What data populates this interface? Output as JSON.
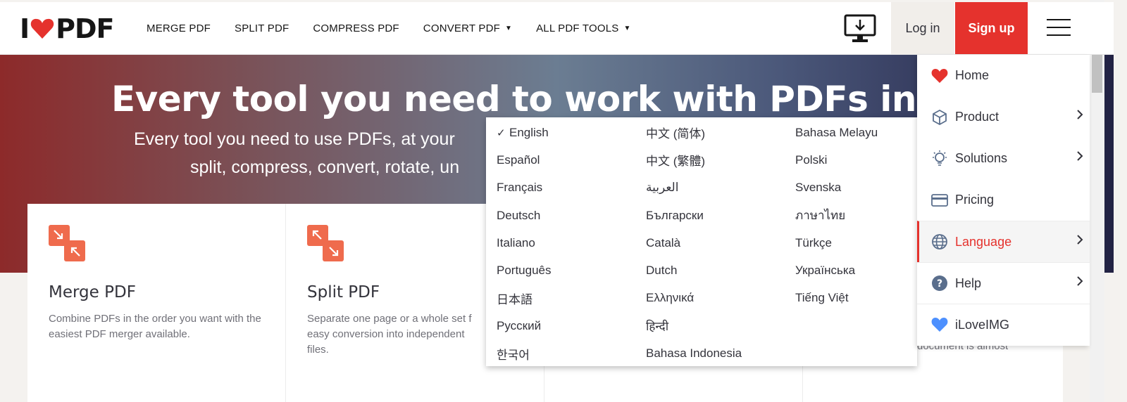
{
  "header": {
    "logo_left": "I",
    "logo_right": "PDF",
    "nav": [
      {
        "label": "MERGE PDF",
        "caret": false
      },
      {
        "label": "SPLIT PDF",
        "caret": false
      },
      {
        "label": "COMPRESS PDF",
        "caret": false
      },
      {
        "label": "CONVERT PDF",
        "caret": true
      },
      {
        "label": "ALL PDF TOOLS",
        "caret": true
      }
    ],
    "login_label": "Log in",
    "signup_label": "Sign up"
  },
  "hero": {
    "title": "Every tool you need to work with PDFs in one pl",
    "subtitle_line1": "Every tool you need to use PDFs, at your",
    "subtitle_line2": "split, compress, convert, rotate, un"
  },
  "tools": [
    {
      "name": "Merge PDF",
      "desc": "Combine PDFs in the order you want with the easiest PDF merger available."
    },
    {
      "name": "Split PDF",
      "desc": "Separate one page or a whole set f easy conversion into independent files."
    }
  ],
  "hidden_tool_text": "document is almost",
  "languages": {
    "selected": "English",
    "col1": [
      "English",
      "Español",
      "Français",
      "Deutsch",
      "Italiano",
      "Português",
      "日本語",
      "Русский",
      "한국어"
    ],
    "col2": [
      "中文 (简体)",
      "中文 (繁體)",
      "العربية",
      "Български",
      "Català",
      "Dutch",
      "Ελληνικά",
      "हिन्दी",
      "Bahasa Indonesia"
    ],
    "col3": [
      "Bahasa Melayu",
      "Polski",
      "Svenska",
      "ภาษาไทย",
      "Türkçe",
      "Українська",
      "Tiếng Việt"
    ]
  },
  "side_menu": [
    {
      "label": "Home",
      "icon": "heart-icon",
      "chevron": false,
      "active": false
    },
    {
      "label": "Product",
      "icon": "cube-icon",
      "chevron": true,
      "active": false
    },
    {
      "label": "Solutions",
      "icon": "lightbulb-icon",
      "chevron": true,
      "active": false
    },
    {
      "label": "Pricing",
      "icon": "credit-card-icon",
      "chevron": false,
      "active": false
    },
    {
      "label": "Language",
      "icon": "globe-icon",
      "chevron": true,
      "active": true
    },
    {
      "label": "Help",
      "icon": "question-icon",
      "chevron": true,
      "active": false
    },
    {
      "label": "iLoveIMG",
      "icon": "blue-heart-icon",
      "chevron": false,
      "active": false
    }
  ],
  "colors": {
    "brand_red": "#e5322d",
    "text": "#33333b",
    "tool_icon": "#ef6b4d",
    "ilovimg_blue": "#4d90fe"
  }
}
